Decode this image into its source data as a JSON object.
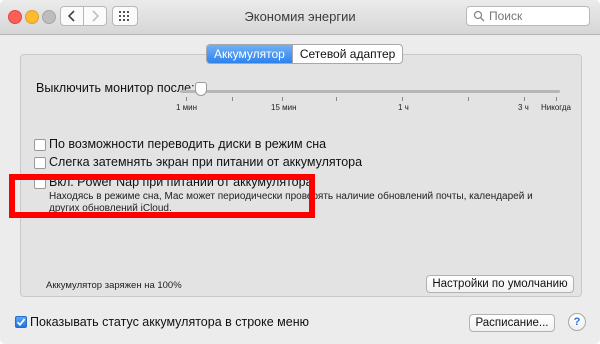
{
  "window": {
    "title": "Экономия энергии"
  },
  "search": {
    "placeholder": "Поиск"
  },
  "icons": {
    "back": "chevron-left-icon",
    "forward": "chevron-right-icon",
    "grid": "grid-icon",
    "search": "search-icon",
    "help": "help-icon"
  },
  "tabs": [
    {
      "label": "Аккумулятор",
      "active": true
    },
    {
      "label": "Сетевой адаптер",
      "active": false
    }
  ],
  "monitor_off": {
    "label": "Выключить монитор после:",
    "ticks": [
      "1 мин",
      "15 мин",
      "1 ч",
      "3 ч",
      "Никогда"
    ]
  },
  "options": [
    {
      "label": "По возможности переводить диски в режим сна",
      "checked": false
    },
    {
      "label": "Слегка затемнять экран при питании от аккумулятора",
      "checked": false
    },
    {
      "label": "Вкл. Power Nap при питании от аккумулятора",
      "checked": false
    }
  ],
  "power_nap_description": "Находясь в режиме сна, Mac может периодически проверять наличие обновлений почты, календарей и других обновлений iCloud.",
  "battery_status": "Аккумулятор заряжен на 100%",
  "buttons": {
    "defaults": "Настройки по умолчанию",
    "schedule": "Расписание...",
    "help": "?"
  },
  "show_status": {
    "label": "Показывать статус аккумулятора в строке меню",
    "checked": true
  },
  "colors": {
    "accent": "#2e82ee",
    "highlight": "#ff0000"
  }
}
